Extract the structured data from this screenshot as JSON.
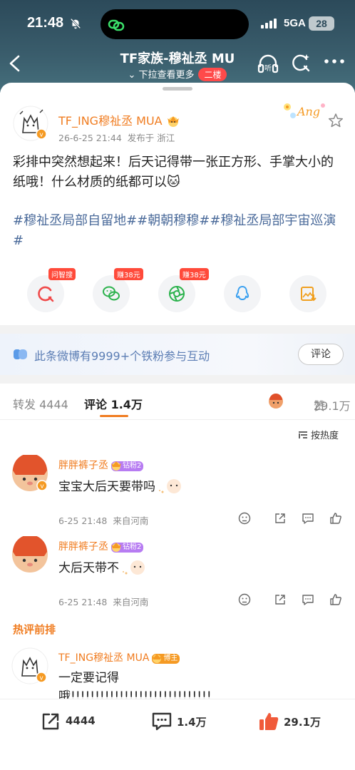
{
  "status_bar": {
    "time": "21:48",
    "network": "5GA",
    "battery": "28"
  },
  "nav": {
    "title": "TF家族-穆祉丞 MU",
    "subtitle": "下拉查看更多",
    "floor_badge": "二楼",
    "listen_label": "听"
  },
  "post": {
    "author": "TF_ING穆祉丞 MUA",
    "time": "26-6-25 21:44",
    "location": "发布于 浙江",
    "text": "彩排中突然想起来！后天记得带一张正方形、手掌大小的纸哦！什么材质的纸都可以🐱",
    "tags": "#穆祉丞局部自留地##朝朝穆穆##穆祉丞局部宇宙巡演#",
    "sticker_text": "Ang"
  },
  "share_buttons": [
    {
      "name": "wenzhisou",
      "icon": "ai-search-icon",
      "tag": "问智搜",
      "color": "#f04a4a"
    },
    {
      "name": "wechat",
      "icon": "wechat-icon",
      "tag": "赚38元",
      "color": "#2bb24c"
    },
    {
      "name": "moments",
      "icon": "moments-icon",
      "tag": "赚38元",
      "color": "#2bb24c"
    },
    {
      "name": "qq",
      "icon": "qq-icon",
      "tag": "",
      "color": "#3aa0f0"
    },
    {
      "name": "save-image",
      "icon": "save-image-icon",
      "tag": "",
      "color": "#f0a020"
    }
  ],
  "fan_bar": {
    "text": "此条微博有9999+个铁粉参与互动",
    "button": "评论"
  },
  "tabs": {
    "repost_label": "转发",
    "repost_count": "4444",
    "comment_label": "评论",
    "comment_count": "1.4万",
    "likes_label": "赞",
    "likes_count": "29.1万"
  },
  "sort_label": "按热度",
  "comments": [
    {
      "user": "胖胖裤子丞",
      "badge": "钻粉2",
      "text": "宝宝大后天要带吗",
      "time": "6-25 21:48",
      "location": "来自河南"
    },
    {
      "user": "胖胖裤子丞",
      "badge": "钻粉2",
      "text": "大后天带不",
      "time": "6-25 21:48",
      "location": "来自河南"
    }
  ],
  "hot_label": "热评前排",
  "hot_comment": {
    "user": "TF_ING穆祉丞 MUA",
    "badge": "博主",
    "line1": "一定要记得",
    "line2": "哦!!!!!!!!!!!!!!!!!!!!!!!!!!!!!"
  },
  "bottom_bar": {
    "repost": "4444",
    "comment": "1.4万",
    "like": "29.1万"
  },
  "colors": {
    "accent": "#f07c20",
    "link": "#4a6a9a",
    "header": "#2c4a5a",
    "like": "#f05a3a"
  }
}
